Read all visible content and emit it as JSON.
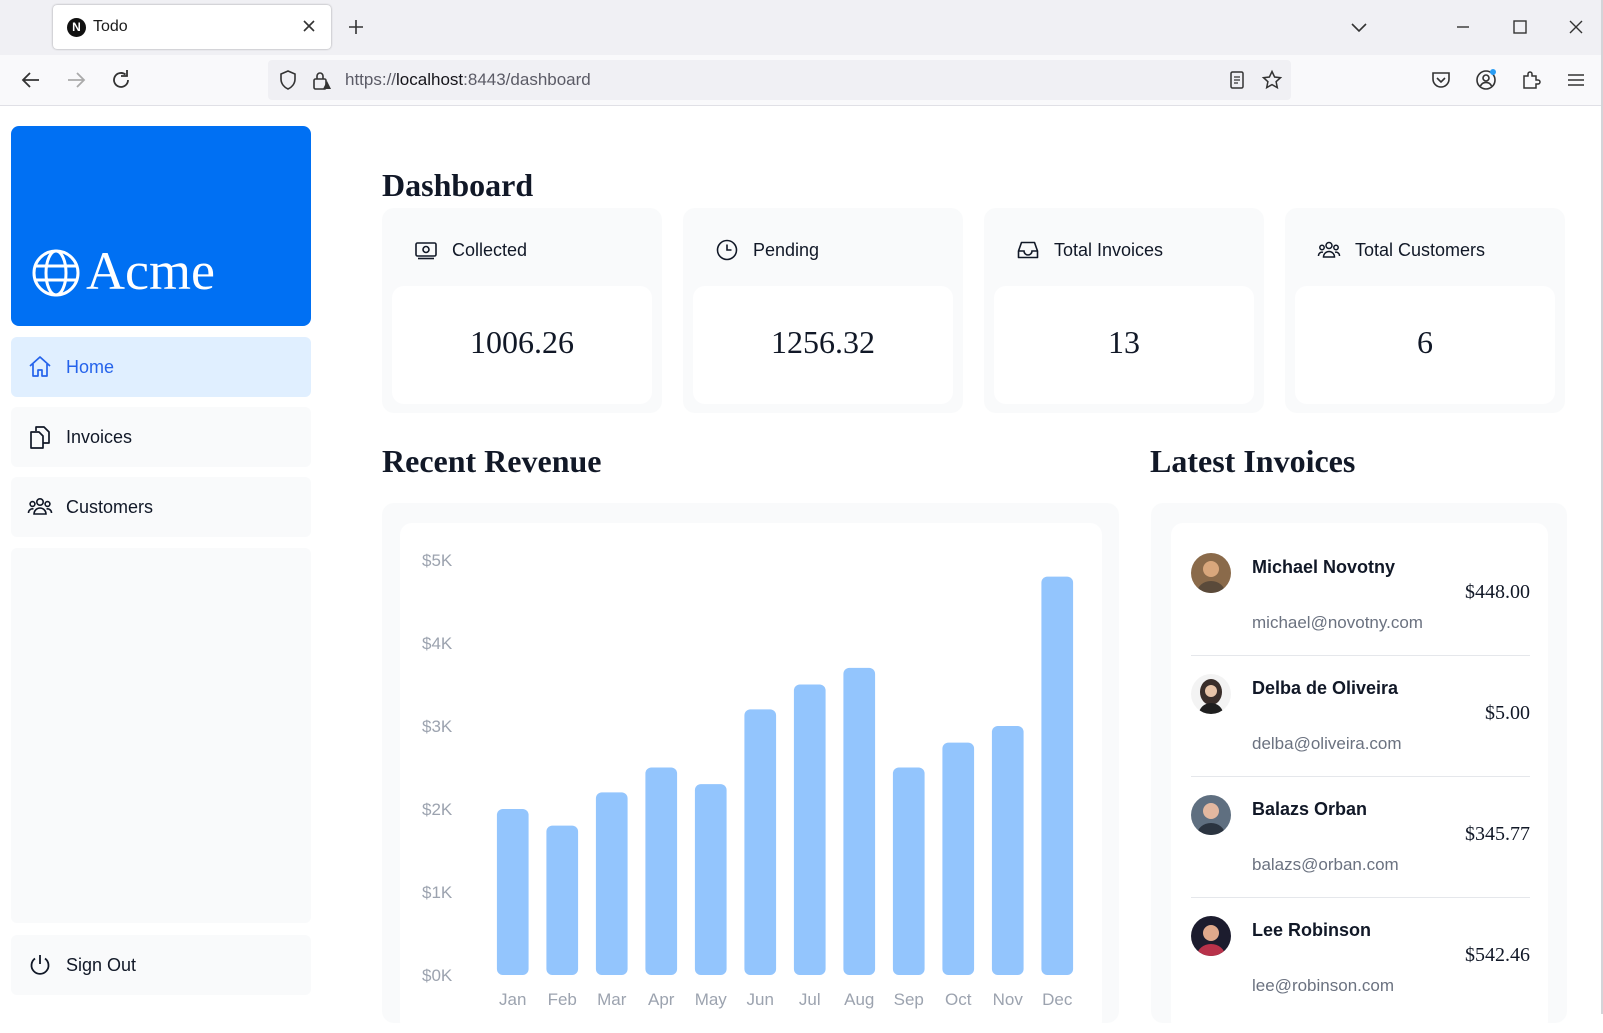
{
  "browser": {
    "tab_title": "Todo",
    "tab_favicon_letter": "N",
    "url_scheme": "https://",
    "url_host": "localhost",
    "url_rest": ":8443/dashboard"
  },
  "sidebar": {
    "logo_text": "Acme",
    "brand_color": "#0070f3",
    "items": [
      {
        "label": "Home",
        "icon": "home-icon",
        "active": true
      },
      {
        "label": "Invoices",
        "icon": "document-duplicate-icon",
        "active": false
      },
      {
        "label": "Customers",
        "icon": "user-group-icon",
        "active": false
      }
    ],
    "signout_label": "Sign Out"
  },
  "dashboard": {
    "title": "Dashboard",
    "cards": [
      {
        "title": "Collected",
        "value": "1006.26",
        "icon": "banknotes-icon"
      },
      {
        "title": "Pending",
        "value": "1256.32",
        "icon": "clock-icon"
      },
      {
        "title": "Total Invoices",
        "value": "13",
        "icon": "inbox-icon"
      },
      {
        "title": "Total Customers",
        "value": "6",
        "icon": "user-group-icon"
      }
    ],
    "revenue_title": "Recent Revenue",
    "invoices_title": "Latest Invoices",
    "latest_invoices": [
      {
        "name": "Michael Novotny",
        "email": "michael@novotny.com",
        "amount": "$448.00",
        "avatar_color": "#8a6a4a"
      },
      {
        "name": "Delba de Oliveira",
        "email": "delba@oliveira.com",
        "amount": "$5.00",
        "avatar_color": "#3a2e2a"
      },
      {
        "name": "Balazs Orban",
        "email": "balazs@orban.com",
        "amount": "$345.77",
        "avatar_color": "#5f6f80"
      },
      {
        "name": "Lee Robinson",
        "email": "lee@robinson.com",
        "amount": "$542.46",
        "avatar_color": "#1c1c2e"
      }
    ]
  },
  "chart_data": {
    "type": "bar",
    "categories": [
      "Jan",
      "Feb",
      "Mar",
      "Apr",
      "May",
      "Jun",
      "Jul",
      "Aug",
      "Sep",
      "Oct",
      "Nov",
      "Dec"
    ],
    "values": [
      2000,
      1800,
      2200,
      2500,
      2300,
      3200,
      3500,
      3700,
      2500,
      2800,
      3000,
      4800
    ],
    "ylim": [
      0,
      5000
    ],
    "ytick_labels": [
      "$0K",
      "$1K",
      "$2K",
      "$3K",
      "$4K",
      "$5K"
    ],
    "bar_color": "#93c5fd",
    "title": "",
    "xlabel": "",
    "ylabel": ""
  }
}
